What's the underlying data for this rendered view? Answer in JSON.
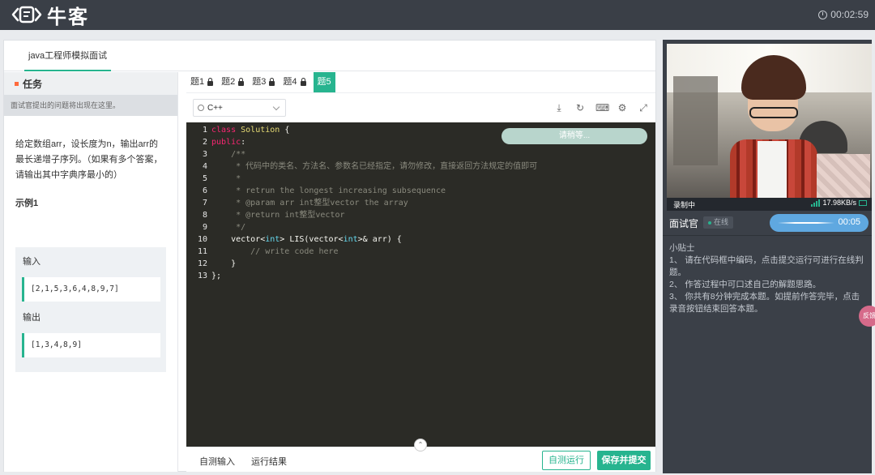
{
  "topbar": {
    "logo_text": "牛客",
    "timer": "00:02:59"
  },
  "main": {
    "tab_label": "java工程师模拟面试"
  },
  "task": {
    "title": "任务",
    "hint": "面试官提出的问题将出现在这里。",
    "description": "给定数组arr，设长度为n，输出arr的最长递增子序列。（如果有多个答案，请输出其中字典序最小的）",
    "example_title": "示例1",
    "input_label": "输入",
    "input_value": "[2,1,5,3,6,4,8,9,7]",
    "output_label": "输出",
    "output_value": "[1,3,4,8,9]"
  },
  "editor": {
    "question_tabs": [
      "题1",
      "题2",
      "题3",
      "题4",
      "题5"
    ],
    "active_tab": "题5",
    "language": "C++",
    "waiting_text": "请稍等...",
    "code_lines": [
      {
        "n": "1",
        "text": "class Solution {"
      },
      {
        "n": "2",
        "text": "public:"
      },
      {
        "n": "3",
        "text": "    /**"
      },
      {
        "n": "4",
        "text": "     * 代码中的类名、方法名、参数名已经指定，请勿修改，直接返回方法规定的值即可"
      },
      {
        "n": "5",
        "text": "     *"
      },
      {
        "n": "6",
        "text": "     * retrun the longest increasing subsequence"
      },
      {
        "n": "7",
        "text": "     * @param arr int整型vector the array"
      },
      {
        "n": "8",
        "text": "     * @return int整型vector"
      },
      {
        "n": "9",
        "text": "     */"
      },
      {
        "n": "10",
        "text": "    vector<int> LIS(vector<int>& arr) {"
      },
      {
        "n": "11",
        "text": "        // write code here"
      },
      {
        "n": "12",
        "text": "    }"
      },
      {
        "n": "13",
        "text": "};"
      }
    ],
    "bottom_tabs": [
      "自测输入",
      "运行结果"
    ],
    "run_button": "自测运行",
    "submit_button": "保存并提交"
  },
  "side": {
    "recording": "录制中",
    "network": "17.98KB/s",
    "interviewer_label": "面试官",
    "status": "在线",
    "audio_time": "00:05",
    "tips_title": "小贴士",
    "tips": [
      "1、 请在代码框中编码，点击提交运行可进行在线判题。",
      "2、 作答过程中可口述自己的解题思路。",
      "3、 你共有8分钟完成本题。如提前作答完毕，点击录音按钮结束回答本题。"
    ],
    "float_button": "反馈"
  },
  "colors": {
    "accent": "#27b48f",
    "topbar": "#3a3f47",
    "side_panel": "#3b4048",
    "editor_bg": "#2b2b26"
  }
}
